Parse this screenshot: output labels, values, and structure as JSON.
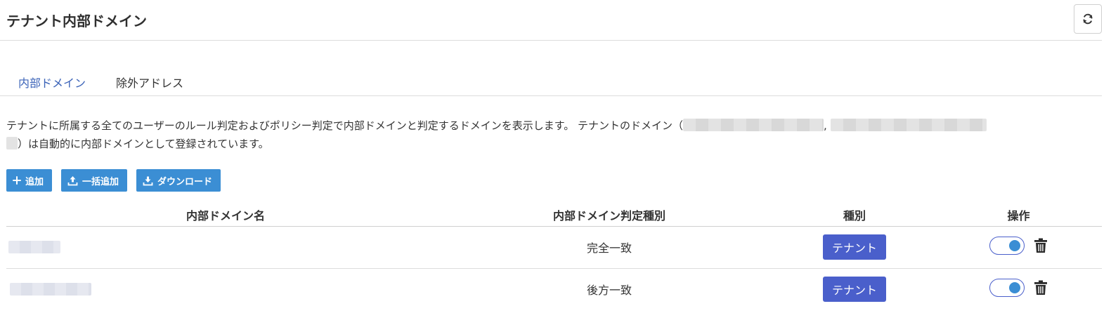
{
  "header": {
    "title": "テナント内部ドメイン",
    "refresh_icon": "refresh-icon"
  },
  "tabs": [
    {
      "label": "内部ドメイン",
      "active": true
    },
    {
      "label": "除外アドレス",
      "active": false
    }
  ],
  "description": {
    "text_before": "テナントに所属する全てのユーザーのルール判定およびポリシー判定で内部ドメインと判定するドメインを表示します。 テナントのドメイン（",
    "separator": ",",
    "text_after": "）は自動的に内部ドメインとして登録されています。"
  },
  "toolbar": {
    "add_label": "追加",
    "bulk_add_label": "一括追加",
    "download_label": "ダウンロード"
  },
  "table": {
    "headers": [
      "内部ドメイン名",
      "内部ドメイン判定種別",
      "種別",
      "操作"
    ],
    "rows": [
      {
        "match_type": "完全一致",
        "kind": "テナント",
        "enabled": true
      },
      {
        "match_type": "後方一致",
        "kind": "テナント",
        "enabled": true
      }
    ]
  },
  "colors": {
    "accent_blue": "#3b8ed4",
    "badge_indigo": "#4a5fcb",
    "tab_active": "#3b63b8"
  }
}
